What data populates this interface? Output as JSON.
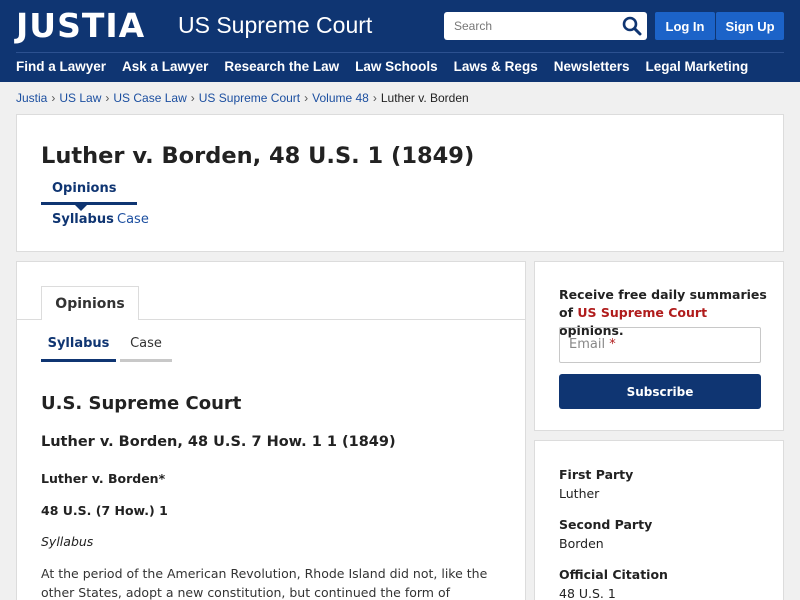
{
  "header": {
    "logo": "JUSTIA",
    "section_title": "US Supreme Court",
    "search_placeholder": "Search",
    "login_label": "Log In",
    "signup_label": "Sign Up",
    "nav": [
      "Find a Lawyer",
      "Ask a Lawyer",
      "Research the Law",
      "Law Schools",
      "Laws & Regs",
      "Newsletters",
      "Legal Marketing"
    ]
  },
  "breadcrumb": {
    "links": [
      "Justia",
      "US Law",
      "US Case Law",
      "US Supreme Court",
      "Volume 48"
    ],
    "separator": "›",
    "current": "Luther v. Borden"
  },
  "title_card": {
    "title": "Luther v. Borden, 48 U.S. 1 (1849)",
    "tab_opinions": "Opinions",
    "tab_syllabus": "Syllabus",
    "tab_case": "Case"
  },
  "main": {
    "tab_opinions": "Opinions",
    "tab_syllabus": "Syllabus",
    "tab_case": "Case",
    "court": "U.S. Supreme Court",
    "case_heading": "Luther v. Borden, 48 U.S. 7 How. 1 1 (1849)",
    "case_name": "Luther v. Borden*",
    "citation": "48 U.S. (7 How.) 1",
    "section": "Syllabus",
    "paragraph": "At the period of the American Revolution, Rhode Island did not, like the other States, adopt a new constitution, but continued the form of government"
  },
  "subscribe": {
    "text_prefix": "Receive free daily summaries of",
    "text_highlight": "US Supreme Court",
    "text_suffix": "opinions.",
    "email_label": "Email",
    "required_mark": "*",
    "button": "Subscribe"
  },
  "facts": {
    "first_party_label": "First Party",
    "first_party": "Luther",
    "second_party_label": "Second Party",
    "second_party": "Borden",
    "citation_label": "Official Citation",
    "citation": "48 U.S. 1"
  },
  "colors": {
    "header_bg": "#0f3572",
    "button_blue": "#1c63c8",
    "accent_red": "#b01c1c",
    "link_blue": "#1c4fa0"
  },
  "icons": {
    "search": "search-icon"
  }
}
